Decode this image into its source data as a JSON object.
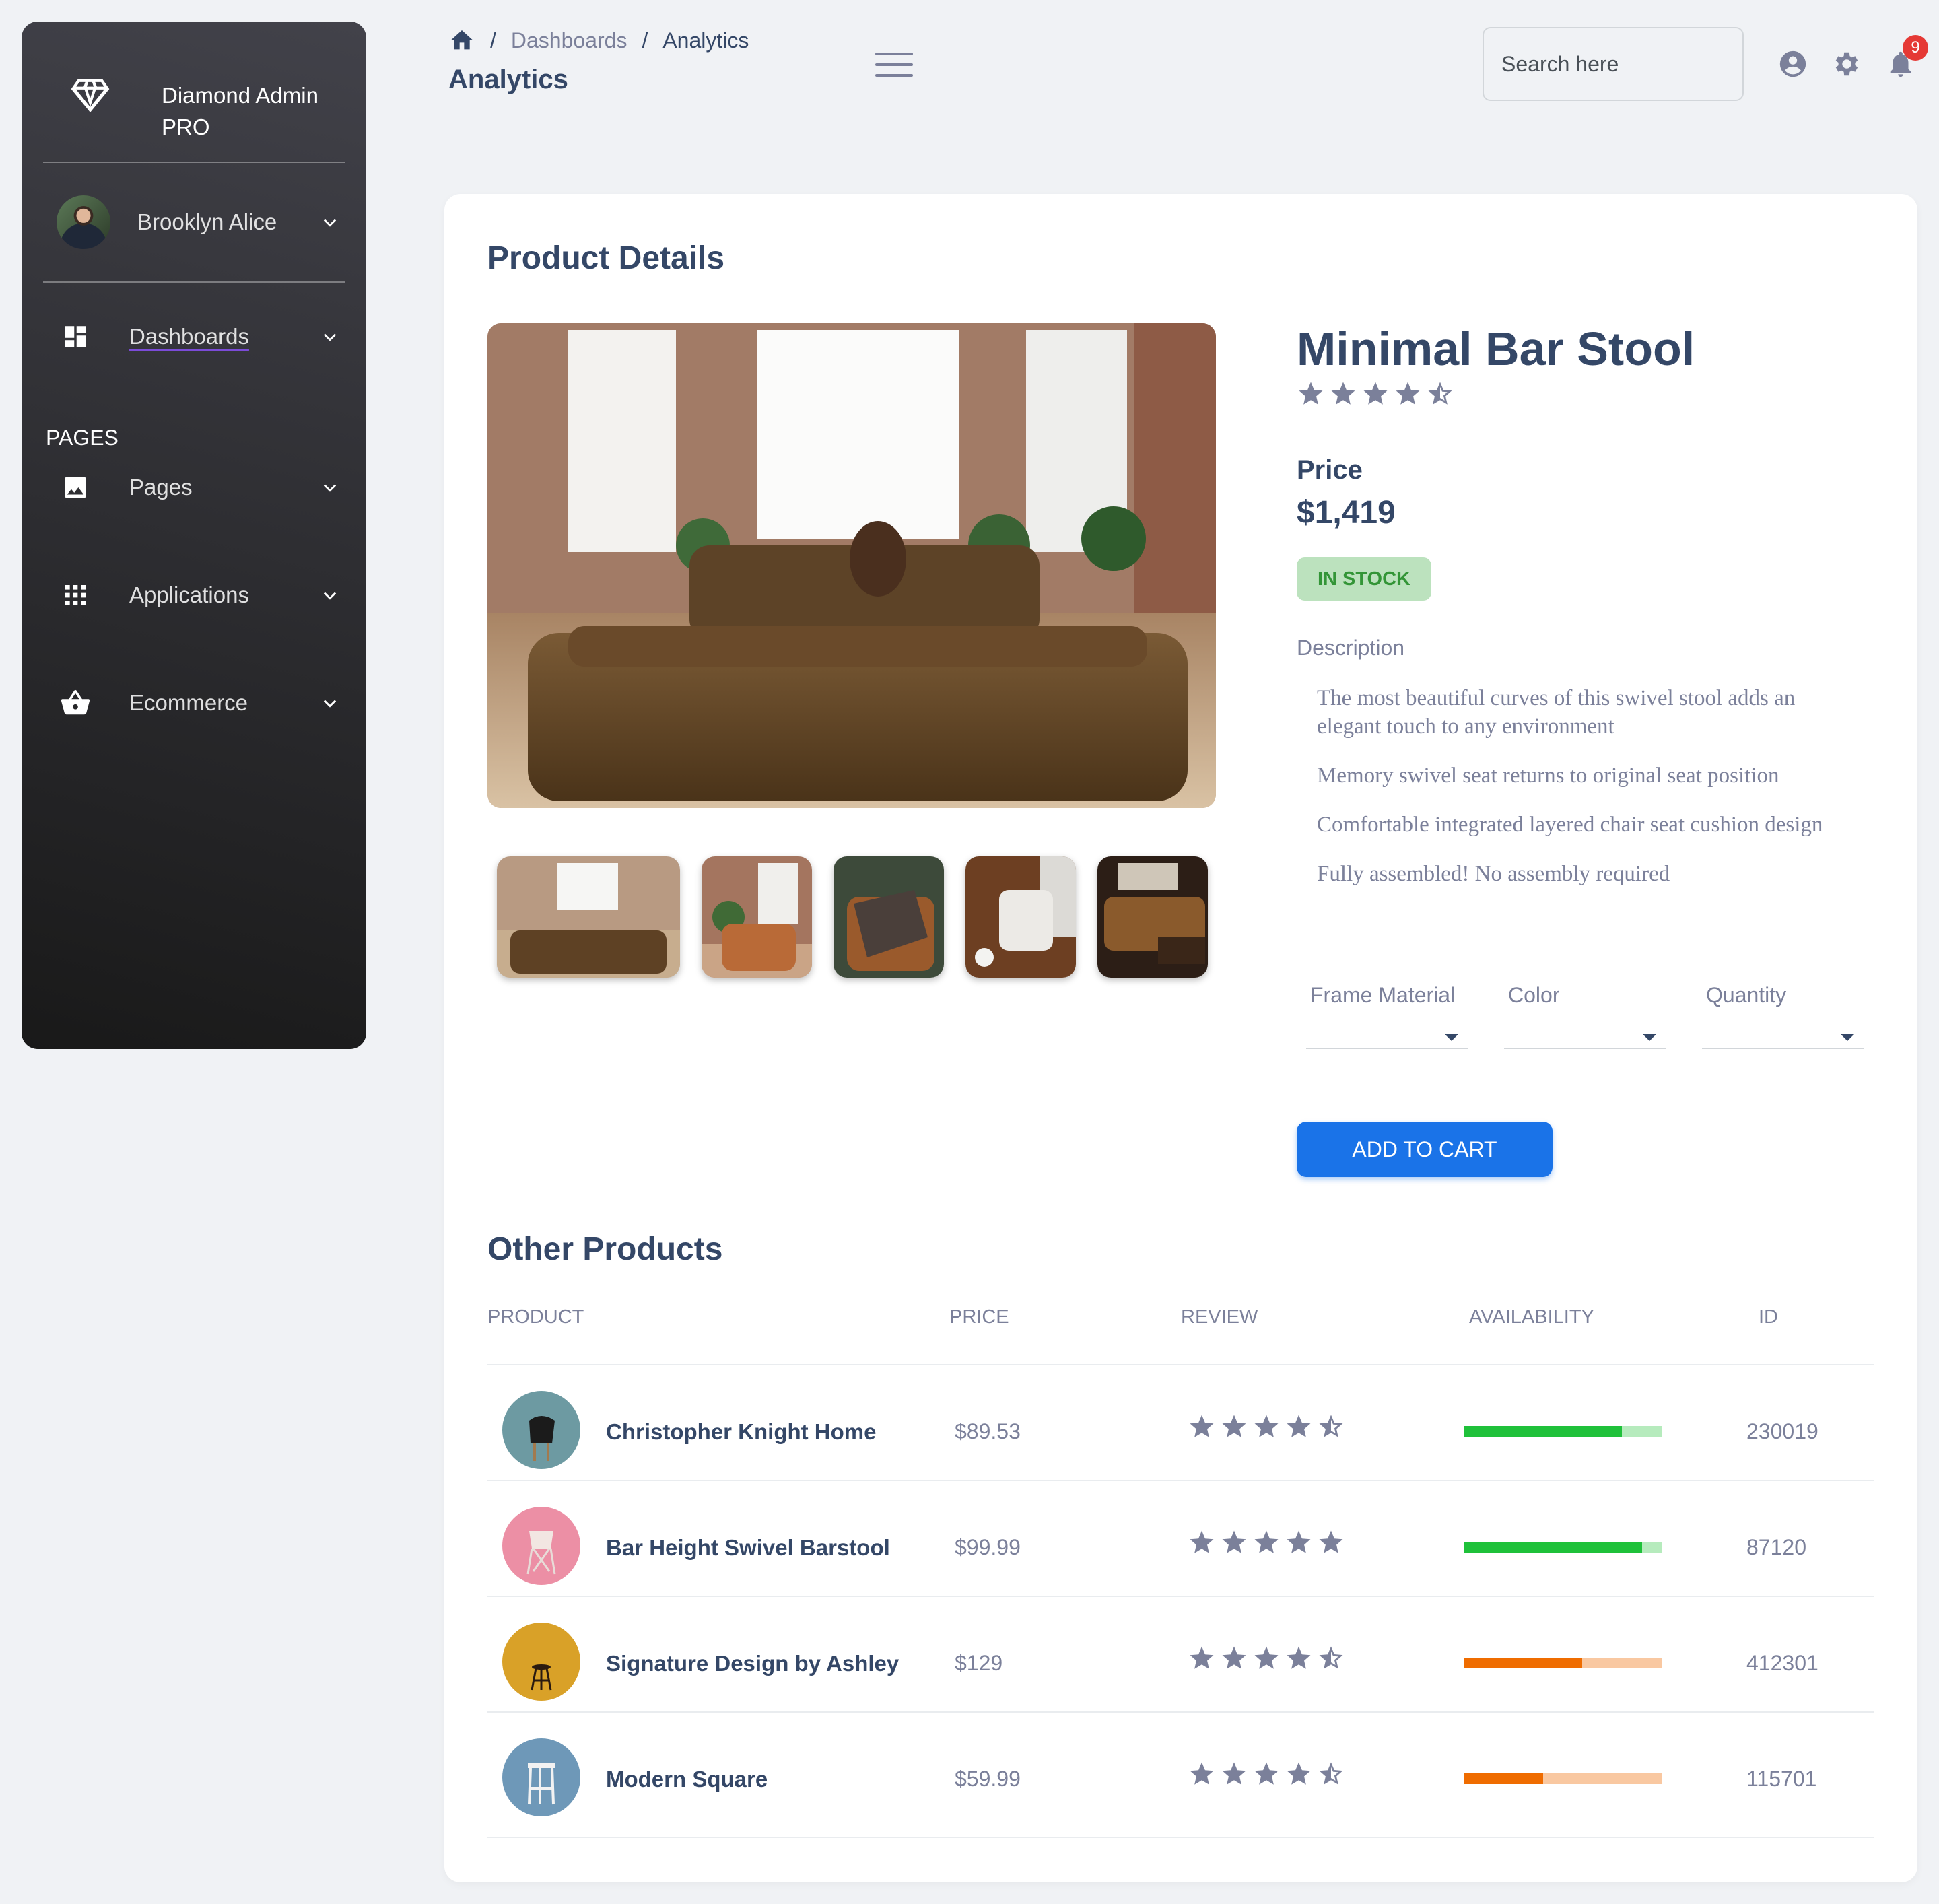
{
  "brand": {
    "name": "Diamond Admin PRO"
  },
  "user": {
    "name": "Brooklyn Alice"
  },
  "sidebar": {
    "section_heading": "PAGES",
    "items": [
      {
        "label": "Dashboards",
        "icon": "dashboard-icon"
      },
      {
        "label": "Pages",
        "icon": "image-icon"
      },
      {
        "label": "Applications",
        "icon": "apps-icon"
      },
      {
        "label": "Ecommerce",
        "icon": "basket-icon"
      }
    ]
  },
  "header": {
    "breadcrumb": [
      "Dashboards",
      "Analytics"
    ],
    "title": "Analytics",
    "search_placeholder": "Search here",
    "notification_count": "9"
  },
  "product": {
    "section_title": "Product Details",
    "name": "Minimal Bar Stool",
    "rating": 4.5,
    "price_label": "Price",
    "price": "$1,419",
    "stock_status": "IN STOCK",
    "description_label": "Description",
    "description": [
      "The most beautiful curves of this swivel stool adds an elegant touch to any environment",
      "Memory swivel seat returns to original seat position",
      "Comfortable integrated layered chair seat cushion design",
      "Fully assembled! No assembly required"
    ],
    "selects": [
      {
        "label": "Frame Material",
        "value": ""
      },
      {
        "label": "Color",
        "value": ""
      },
      {
        "label": "Quantity",
        "value": ""
      }
    ],
    "add_to_cart": "ADD TO CART"
  },
  "other_products": {
    "title": "Other Products",
    "columns": [
      "PRODUCT",
      "PRICE",
      "REVIEW",
      "AVAILABILITY",
      "ID"
    ],
    "rows": [
      {
        "name": "Christopher Knight Home",
        "price": "$89.53",
        "rating": 4.5,
        "availability": 0.8,
        "bar_color": "#1fc13a",
        "bar_track": "#b6ebbd",
        "id": "230019"
      },
      {
        "name": "Bar Height Swivel Barstool",
        "price": "$99.99",
        "rating": 5,
        "availability": 0.9,
        "bar_color": "#1fc13a",
        "bar_track": "#b6ebbd",
        "id": "87120"
      },
      {
        "name": "Signature Design by Ashley",
        "price": "$129",
        "rating": 4.5,
        "availability": 0.6,
        "bar_color": "#ef6c00",
        "bar_track": "#f9c8a1",
        "id": "412301"
      },
      {
        "name": "Modern Square",
        "price": "$59.99",
        "rating": 4.5,
        "availability": 0.4,
        "bar_color": "#ef6c00",
        "bar_track": "#f9c8a1",
        "id": "115701"
      }
    ]
  },
  "colors": {
    "primary": "#1a73e8",
    "heading": "#344767",
    "muted": "#7b809a",
    "success_bg": "#bce2be",
    "success_text": "#339537"
  }
}
